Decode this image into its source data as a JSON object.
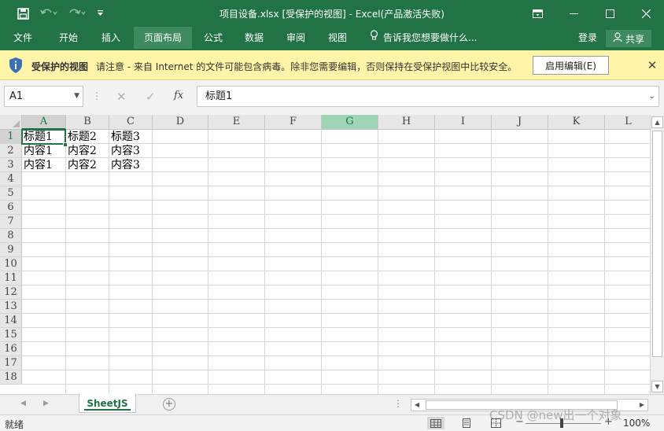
{
  "window": {
    "title": "项目设备.xlsx  [受保护的视图] - Excel(产品激活失败)"
  },
  "quick_access": {
    "save_icon": "save-icon",
    "undo_icon": "undo-icon",
    "redo_icon": "redo-icon",
    "customize_icon": "customize-icon"
  },
  "ribbon": {
    "tabs": [
      {
        "label": "文件",
        "active": false
      },
      {
        "label": "开始",
        "active": false
      },
      {
        "label": "插入",
        "active": false
      },
      {
        "label": "页面布局",
        "active": true
      },
      {
        "label": "公式",
        "active": false
      },
      {
        "label": "数据",
        "active": false
      },
      {
        "label": "审阅",
        "active": false
      },
      {
        "label": "视图",
        "active": false
      }
    ],
    "tell_me": "告诉我您想要做什么...",
    "login": "登录",
    "share": "共享"
  },
  "protected_view": {
    "title": "受保护的视图",
    "message": "请注意 - 来自 Internet 的文件可能包含病毒。除非您需要编辑，否则保持在受保护视图中比较安全。",
    "enable_button": "启用编辑(E)"
  },
  "formula_bar": {
    "name_box": "A1",
    "fx_label": "fx",
    "formula": "标题1"
  },
  "sheet": {
    "columns": [
      "A",
      "B",
      "C",
      "D",
      "E",
      "F",
      "G",
      "H",
      "I",
      "J",
      "K",
      "L"
    ],
    "selected_column": "A",
    "highlighted_column": "G",
    "rows": [
      "1",
      "2",
      "3",
      "4",
      "5",
      "6",
      "7",
      "8",
      "9",
      "10",
      "11",
      "12",
      "13",
      "14",
      "15",
      "16",
      "17",
      "18"
    ],
    "selected_row": "1",
    "cells": [
      [
        "标题1",
        "标题2",
        "标题3"
      ],
      [
        "内容1",
        "内容2",
        "内容3"
      ],
      [
        "内容1",
        "内容2",
        "内容3"
      ]
    ],
    "active_cell": "A1"
  },
  "sheet_tabs": {
    "tabs": [
      "SheetJS"
    ],
    "active": "SheetJS"
  },
  "status_bar": {
    "status": "就绪",
    "zoom": "100%"
  },
  "watermark": "CSDN @new出一个对象",
  "colors": {
    "accent": "#217346",
    "ribbon_active": "#3d8a5f",
    "protected_bar": "#fff4a8",
    "highlight_column": "#9fd5b7"
  }
}
